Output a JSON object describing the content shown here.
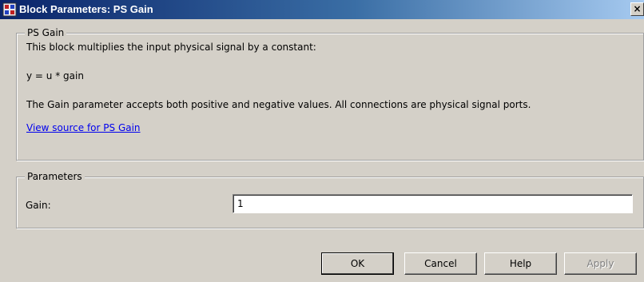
{
  "window": {
    "title": "Block Parameters: PS Gain",
    "close_label": "×"
  },
  "description": {
    "legend": "PS Gain",
    "line1": "This block multiplies the input physical signal by a constant:",
    "equation": "y = u * gain",
    "line2": "The Gain parameter accepts both positive and negative values. All connections are physical signal ports.",
    "link": "View source for PS Gain"
  },
  "parameters": {
    "legend": "Parameters",
    "gain_label": "Gain:",
    "gain_value": "1"
  },
  "buttons": {
    "ok": "OK",
    "cancel": "Cancel",
    "help": "Help",
    "apply": "Apply"
  },
  "colors": {
    "title_gradient_start": "#0a246a",
    "title_gradient_end": "#a6caf0",
    "dialog_bg": "#d4d0c8",
    "link": "#0000ee"
  }
}
